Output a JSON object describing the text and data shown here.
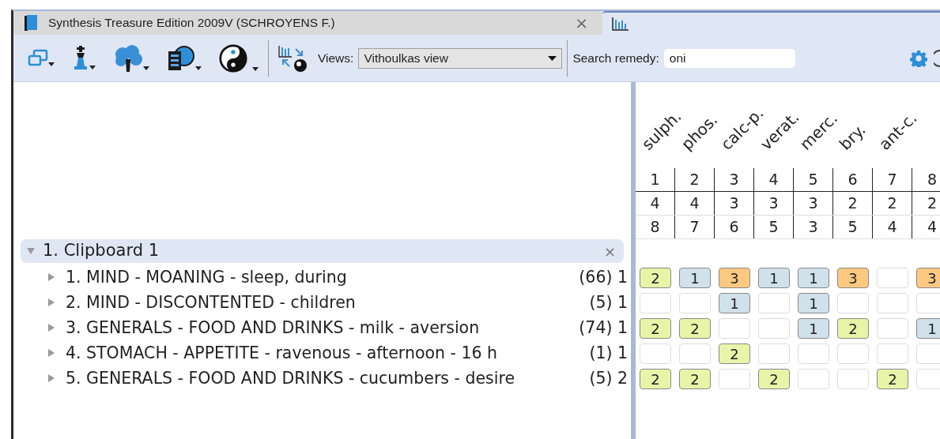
{
  "tabs": [
    {
      "title": "Synthesis Treasure Edition 2009V (SCHROYENS F.)",
      "close": "×",
      "selected": false
    },
    {
      "selected": true
    }
  ],
  "toolbar": {
    "views_label": "Views:",
    "views_value": "Vithoulkas view",
    "search_label": "Search remedy:",
    "search_value": "oni"
  },
  "clipboard": {
    "title": "1. Clipboard 1",
    "expanded": true,
    "close": "×",
    "rubrics": [
      {
        "text": "1. MIND - MOANING - sleep, during",
        "count": "(66) 1",
        "expanded": false
      },
      {
        "text": "2. MIND - DISCONTENTED - children",
        "count": "(5) 1",
        "expanded": false
      },
      {
        "text": "3. GENERALS - FOOD AND DRINKS - milk - aversion",
        "count": "(74) 1",
        "expanded": false
      },
      {
        "text": "4. STOMACH - APPETITE - ravenous - afternoon - 16 h",
        "count": "(1) 1",
        "expanded": false
      },
      {
        "text": "5. GENERALS - FOOD AND DRINKS - cucumbers - desire",
        "count": "(5) 2",
        "expanded": false
      }
    ]
  },
  "remedies": [
    {
      "name": "sulph.",
      "rank": "1",
      "row_2": "4",
      "row_3": "8"
    },
    {
      "name": "phos.",
      "rank": "2",
      "row_2": "4",
      "row_3": "7"
    },
    {
      "name": "calc-p.",
      "rank": "3",
      "row_2": "3",
      "row_3": "6"
    },
    {
      "name": "verat.",
      "rank": "4",
      "row_2": "3",
      "row_3": "5"
    },
    {
      "name": "merc.",
      "rank": "5",
      "row_2": "3",
      "row_3": "3"
    },
    {
      "name": "bry.",
      "rank": "6",
      "row_2": "2",
      "row_3": "5"
    },
    {
      "name": "ant-c.",
      "rank": "7",
      "row_2": "2",
      "row_3": "4"
    },
    {
      "rank": "8",
      "row_2": "2",
      "row_3": "4"
    }
  ],
  "grid": [
    [
      {
        "kind": "grade",
        "value": "2",
        "color": "#e8f5a8"
      },
      {
        "kind": "grade",
        "value": "1",
        "color": "#d0e1ec"
      },
      {
        "kind": "grade",
        "value": "3",
        "color": "#fdc981"
      },
      {
        "kind": "grade",
        "value": "1",
        "color": "#d0e1ec"
      },
      {
        "kind": "grade",
        "value": "1",
        "color": "#d0e1ec"
      },
      {
        "kind": "grade",
        "value": "3",
        "color": "#fdc981"
      },
      {
        "kind": "empty"
      },
      {
        "kind": "grade",
        "value": "3",
        "color": "#fdc981"
      }
    ],
    [
      {
        "kind": "empty"
      },
      {
        "kind": "empty"
      },
      {
        "kind": "grade",
        "value": "1",
        "color": "#d0e1ec"
      },
      {
        "kind": "empty"
      },
      {
        "kind": "grade",
        "value": "1",
        "color": "#d0e1ec"
      },
      {
        "kind": "empty"
      },
      {
        "kind": "empty"
      },
      {
        "kind": "empty"
      }
    ],
    [
      {
        "kind": "grade",
        "value": "2",
        "color": "#e8f5a8"
      },
      {
        "kind": "grade",
        "value": "2",
        "color": "#e8f5a8"
      },
      {
        "kind": "empty"
      },
      {
        "kind": "empty"
      },
      {
        "kind": "grade",
        "value": "1",
        "color": "#d0e1ec"
      },
      {
        "kind": "grade",
        "value": "2",
        "color": "#e8f5a8"
      },
      {
        "kind": "empty"
      },
      {
        "kind": "grade",
        "value": "1",
        "color": "#d0e1ec"
      }
    ],
    [
      {
        "kind": "empty"
      },
      {
        "kind": "empty"
      },
      {
        "kind": "grade",
        "value": "2",
        "color": "#e8f5a8"
      },
      {
        "kind": "empty"
      },
      {
        "kind": "empty"
      },
      {
        "kind": "empty"
      },
      {
        "kind": "empty"
      },
      {
        "kind": "empty"
      }
    ],
    [
      {
        "kind": "grade",
        "value": "2",
        "color": "#e8f5a8"
      },
      {
        "kind": "grade",
        "value": "2",
        "color": "#e8f5a8"
      },
      {
        "kind": "empty"
      },
      {
        "kind": "grade",
        "value": "2",
        "color": "#e8f5a8"
      },
      {
        "kind": "empty"
      },
      {
        "kind": "empty"
      },
      {
        "kind": "grade",
        "value": "2",
        "color": "#e8f5a8"
      },
      {
        "kind": "empty"
      }
    ]
  ]
}
